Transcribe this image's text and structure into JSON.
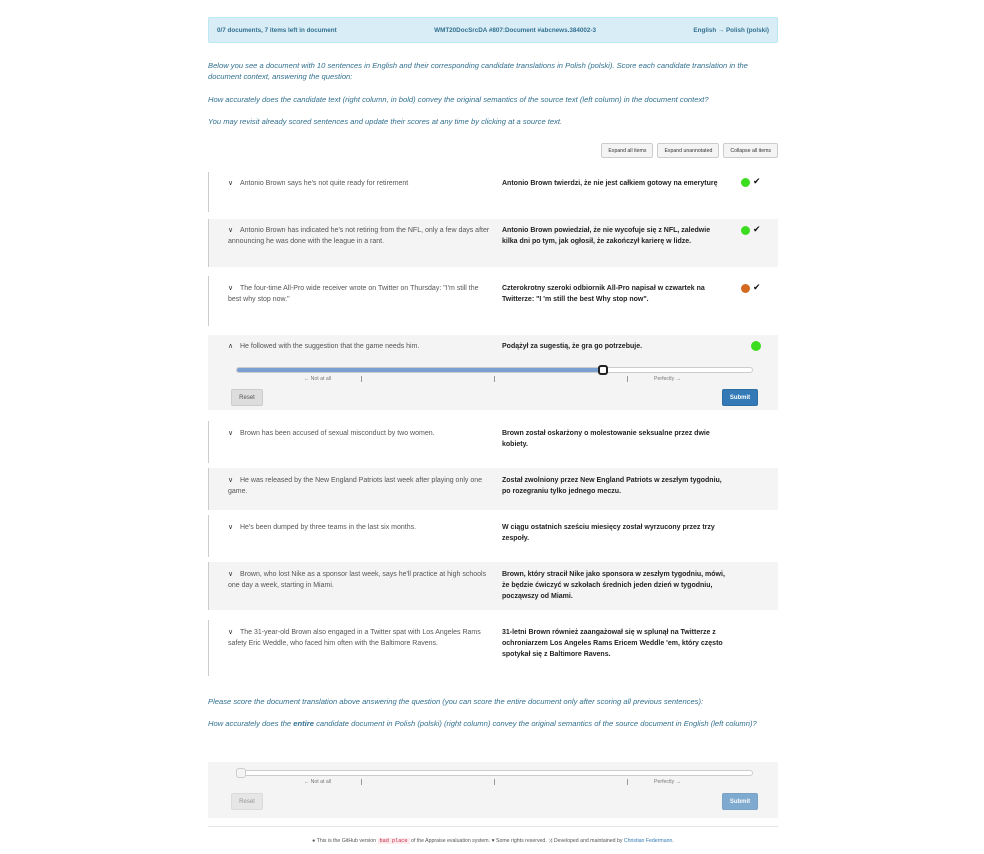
{
  "header": {
    "progress": "0/7 documents, 7 items left in document",
    "doc_id": "WMT20DocSrcDA #807:Document #abcnews.384002-3",
    "language_pair": "English → Polish (polski)"
  },
  "instructions": {
    "intro": "Below you see a document with 10 sentences in English and their corresponding candidate translations in Polish (polski). Score each candidate translation in the document context, answering the question:",
    "question": "How accurately does the candidate text (right column, in bold) convey the original semantics of the source text (left column) in the document context?",
    "revisit": "You may revisit already scored sentences and update their scores at any time by clicking at a source text."
  },
  "toolbar": {
    "expand_all": "Expand all items",
    "expand_unannotated": "Expand unannotated",
    "collapse_all": "Collapse all items"
  },
  "items": [
    {
      "source": "Antonio Brown says he's not quite ready for retirement",
      "target": "Antonio Brown twierdzi, że nie jest całkiem gotowy na emeryturę",
      "status": "green",
      "checked": true
    },
    {
      "source": "Antonio Brown has indicated he's not retiring from the NFL, only a few days after announcing he was done with the league in a rant.",
      "target": "Antonio Brown powiedział, że nie wycofuje się z NFL, zaledwie kilka dni po tym, jak ogłosił, że zakończył karierę w lidze.",
      "status": "green",
      "checked": true
    },
    {
      "source": "The four-time All-Pro wide receiver wrote on Twitter on Thursday: \"I'm still the best why stop now.\"",
      "target": "Czterokrotny szeroki odbiornik All-Pro napisał w czwartek na Twitterze: \"I 'm still the best Why stop now\".",
      "status": "orange",
      "checked": true
    },
    {
      "source": "He followed with the suggestion that the game needs him.",
      "target": "Podążył za sugestią, że gra go potrzebuje.",
      "status": "green",
      "checked": false
    },
    {
      "source": "Brown has been accused of sexual misconduct by two women.",
      "target": "Brown został oskarżony o molestowanie seksualne przez dwie kobiety."
    },
    {
      "source": "He was released by the New England Patriots last week after playing only one game.",
      "target": "Został zwolniony przez New England Patriots w zeszłym tygodniu, po rozegraniu tylko jednego meczu."
    },
    {
      "source": "He's been dumped by three teams in the last six months.",
      "target": "W ciągu ostatnich sześciu miesięcy został wyrzucony przez trzy zespoły."
    },
    {
      "source": "Brown, who lost Nike as a sponsor last week, says he'll practice at high schools one day a week, starting in Miami.",
      "target": "Brown, który stracił Nike jako sponsora w zeszłym tygodniu, mówi, że będzie ćwiczyć w szkołach średnich jeden dzień w tygodniu, począwszy od Miami."
    },
    {
      "source": "The 31-year-old Brown also engaged in a Twitter spat with Los Angeles Rams safety Eric Weddle, who faced him often with the Baltimore Ravens.",
      "target": "31-letni Brown również zaangażował się w splunął na Twitterze z ochroniarzem Los Angeles Rams Ericem Weddle 'em, który często spotykał się z Baltimore Ravens."
    }
  ],
  "active_slider": {
    "label_left": "← Not at all",
    "label_right": "Perfectly →",
    "value_fraction": 0.71,
    "reset": "Reset",
    "submit": "Submit"
  },
  "document_score": {
    "prompt": "Please score the document translation above answering the question (you can score the entire document only after scoring all previous sentences):",
    "question_pre": "How accurately does the ",
    "question_em": "entire",
    "question_post": " candidate document in Polish (polski) (right column) convey the original semantics of the source document in English (left column)?",
    "label_left": "← Not at all",
    "label_right": "Perfectly →",
    "value_fraction": 0,
    "reset": "Reset",
    "submit": "Submit"
  },
  "footer": {
    "part1": "This is the GitHub version",
    "badge": "bad place",
    "part2": "of the Appraise evaluation system.",
    "part3": "Some rights reserved.",
    "part4": "Developed and maintained by",
    "author": "Christian Federmann",
    "end": "."
  },
  "colors": {
    "green": "#3cdc1e",
    "orange": "#d2691e",
    "accent": "#337ab7"
  }
}
